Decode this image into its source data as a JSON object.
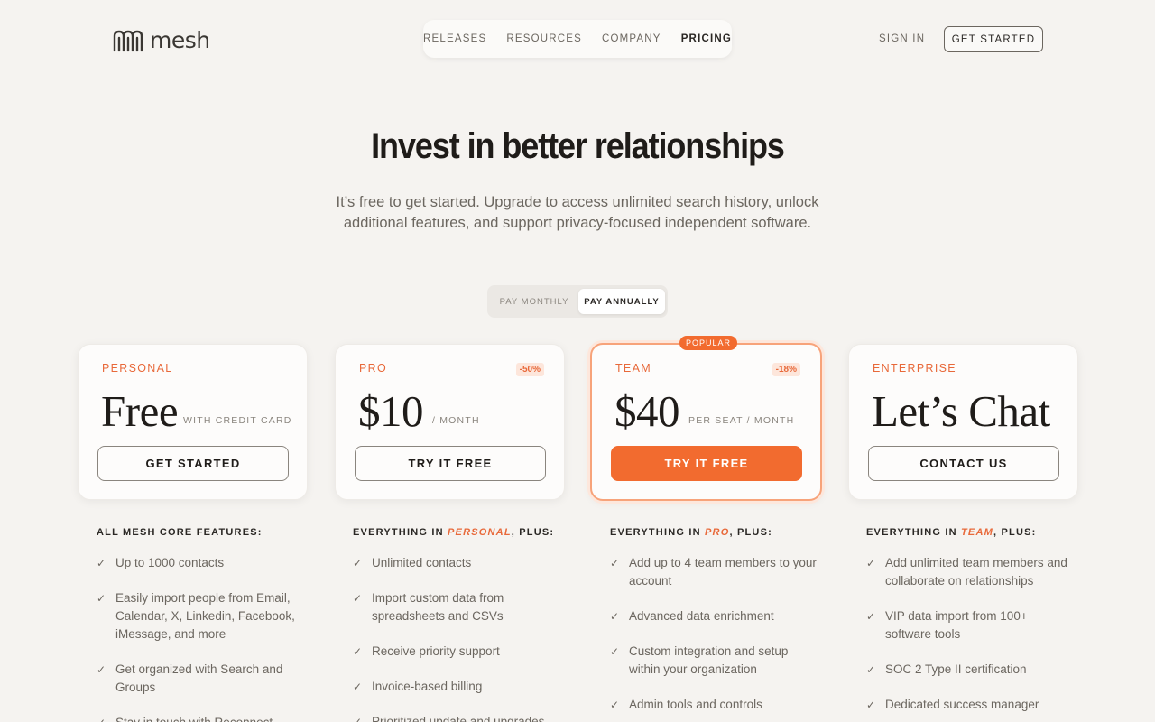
{
  "brand": {
    "name": "mesh"
  },
  "nav": {
    "items": [
      "RELEASES",
      "RESOURCES",
      "COMPANY",
      "PRICING"
    ],
    "active": "PRICING"
  },
  "header": {
    "sign_in": "SIGN IN",
    "get_started": "GET STARTED"
  },
  "hero": {
    "title": "Invest in better relationships",
    "subtitle": "It’s free to get started. Upgrade to access unlimited search history, unlock additional features, and support privacy-focused independent software."
  },
  "billing_toggle": {
    "monthly": "PAY MONTHLY",
    "annually": "PAY ANNUALLY",
    "selected": "PAY ANNUALLY"
  },
  "plans": [
    {
      "name": "PERSONAL",
      "price": "Free",
      "unit": "WITH CREDIT CARD",
      "badge": "",
      "cta": "GET STARTED"
    },
    {
      "name": "PRO",
      "price": "$10",
      "unit": "/ MONTH",
      "badge": "-50%",
      "cta": "TRY IT FREE"
    },
    {
      "name": "TEAM",
      "price": "$40",
      "unit": "PER SEAT / MONTH",
      "badge": "-18%",
      "cta": "TRY IT FREE",
      "tag": "POPULAR"
    },
    {
      "name": "ENTERPRISE",
      "price": "Let’s Chat",
      "unit": "",
      "badge": "",
      "cta": "CONTACT US"
    }
  ],
  "features": [
    {
      "head_pre": "ALL MESH CORE FEATURES:",
      "head_em": "",
      "head_post": "",
      "items": [
        "Up to 1000 contacts",
        "Easily import people from Email, Calendar, X, Linkedin, Facebook, iMessage, and more",
        "Get organized with Search and Groups",
        "Stay in touch with Reconnect"
      ]
    },
    {
      "head_pre": "EVERYTHING IN ",
      "head_em": "PERSONAL",
      "head_post": ", PLUS:",
      "items": [
        "Unlimited contacts",
        "Import custom data from spreadsheets and CSVs",
        "Receive priority support",
        "Invoice-based billing",
        "Prioritized update and upgrades"
      ]
    },
    {
      "head_pre": "EVERYTHING IN ",
      "head_em": "PRO",
      "head_post": ", PLUS:",
      "items": [
        "Add up to 4 team members to your account",
        "Advanced data enrichment",
        "Custom integration and setup within your organization",
        "Admin tools and controls"
      ]
    },
    {
      "head_pre": "EVERYTHING IN ",
      "head_em": "TEAM",
      "head_post": ", PLUS:",
      "items": [
        "Add unlimited team members and collaborate on relationships",
        "VIP data import from 100+ software tools",
        "SOC 2 Type II certification",
        "Dedicated success manager"
      ]
    }
  ],
  "colors": {
    "accent": "#f26b2f",
    "background": "#f5f3f0",
    "text": "#1f1c19"
  }
}
